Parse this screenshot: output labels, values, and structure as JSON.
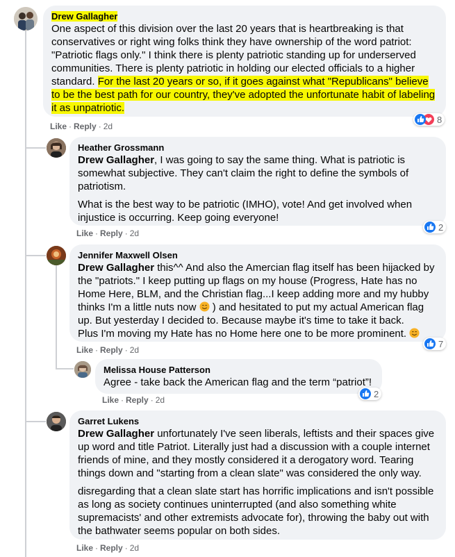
{
  "comments": [
    {
      "author": "Drew Gallagher",
      "text_1": "One aspect of this division over the last 20 years that is heartbreaking is that conservatives or right wing folks think they have ownership of the word patriot: \"Patriotic flags only.\" I think there is plenty patriotic standing up for underserved communities. There is plenty patriotic in holding our elected officials to a higher standard. ",
      "text_hl": "For the last 20 years or so, if it goes against what \"Republicans\" believe to be the best path for our country, they've adopted the unfortunate habit of labeling it as unpatriotic.",
      "like": "Like",
      "reply": "Reply",
      "time": "2d",
      "reaction_count": "8"
    },
    {
      "author": "Heather Grossmann",
      "mention": "Drew Gallagher",
      "text_1": ", I was going to say the same thing. What is patriotic is somewhat subjective. They can't claim the right to define the symbols of patriotism.",
      "text_2": "What is the best way to be patriotic (IMHO), vote! And get involved when injustice is occurring. Keep going everyone!",
      "like": "Like",
      "reply": "Reply",
      "time": "2d",
      "reaction_count": "2"
    },
    {
      "author": "Jennifer Maxwell Olsen",
      "mention": "Drew Gallagher",
      "text_1": " this^^ And also the Amercian flag itself has been hijacked by the \"patriots.\" I keep putting up flags on my house (Progress, Hate has no Home Here, BLM, and the Christian flag...I keep adding more and my hubby thinks I'm a little nuts now ",
      "text_2": " ) and hesitated to put my actual American flag up. But yesterday I decided to. Because maybe it's time to take it back.",
      "text_3": "Plus I'm moving my Hate has no Home here one to be more prominent. ",
      "like": "Like",
      "reply": "Reply",
      "time": "2d",
      "reaction_count": "7"
    },
    {
      "author": "Melissa House Patterson",
      "text_1": "Agree - take back the American flag and the term “patriot”!",
      "like": "Like",
      "reply": "Reply",
      "time": "2d",
      "reaction_count": "2"
    },
    {
      "author": "Garret Lukens",
      "mention": "Drew Gallagher",
      "text_1": " unfortunately I've seen liberals, leftists and their spaces give up word and title Patriot. Literally just had a discussion with a couple internet friends of mine, and they mostly considered it a derogatory word. Tearing things down and \"starting from a clean slate\" was considered the only way.",
      "text_2": "disregarding that a clean slate start has horrific implications and isn't possible as long as society continues uninterrupted (and also something white supremacists' and other extremists advocate for), throwing the baby out with the bathwater seems popular on both sides.",
      "like": "Like",
      "reply": "Reply",
      "time": "2d"
    }
  ],
  "colors": {
    "highlight": "#f7f700",
    "like_blue": "#1877f2",
    "love_red": "#f33e58",
    "bubble": "#f0f2f5",
    "meta_gray": "#65676b"
  },
  "icons": {
    "like": "like-reaction-icon",
    "love": "love-reaction-icon",
    "emoji": "smiling-face-icon"
  }
}
